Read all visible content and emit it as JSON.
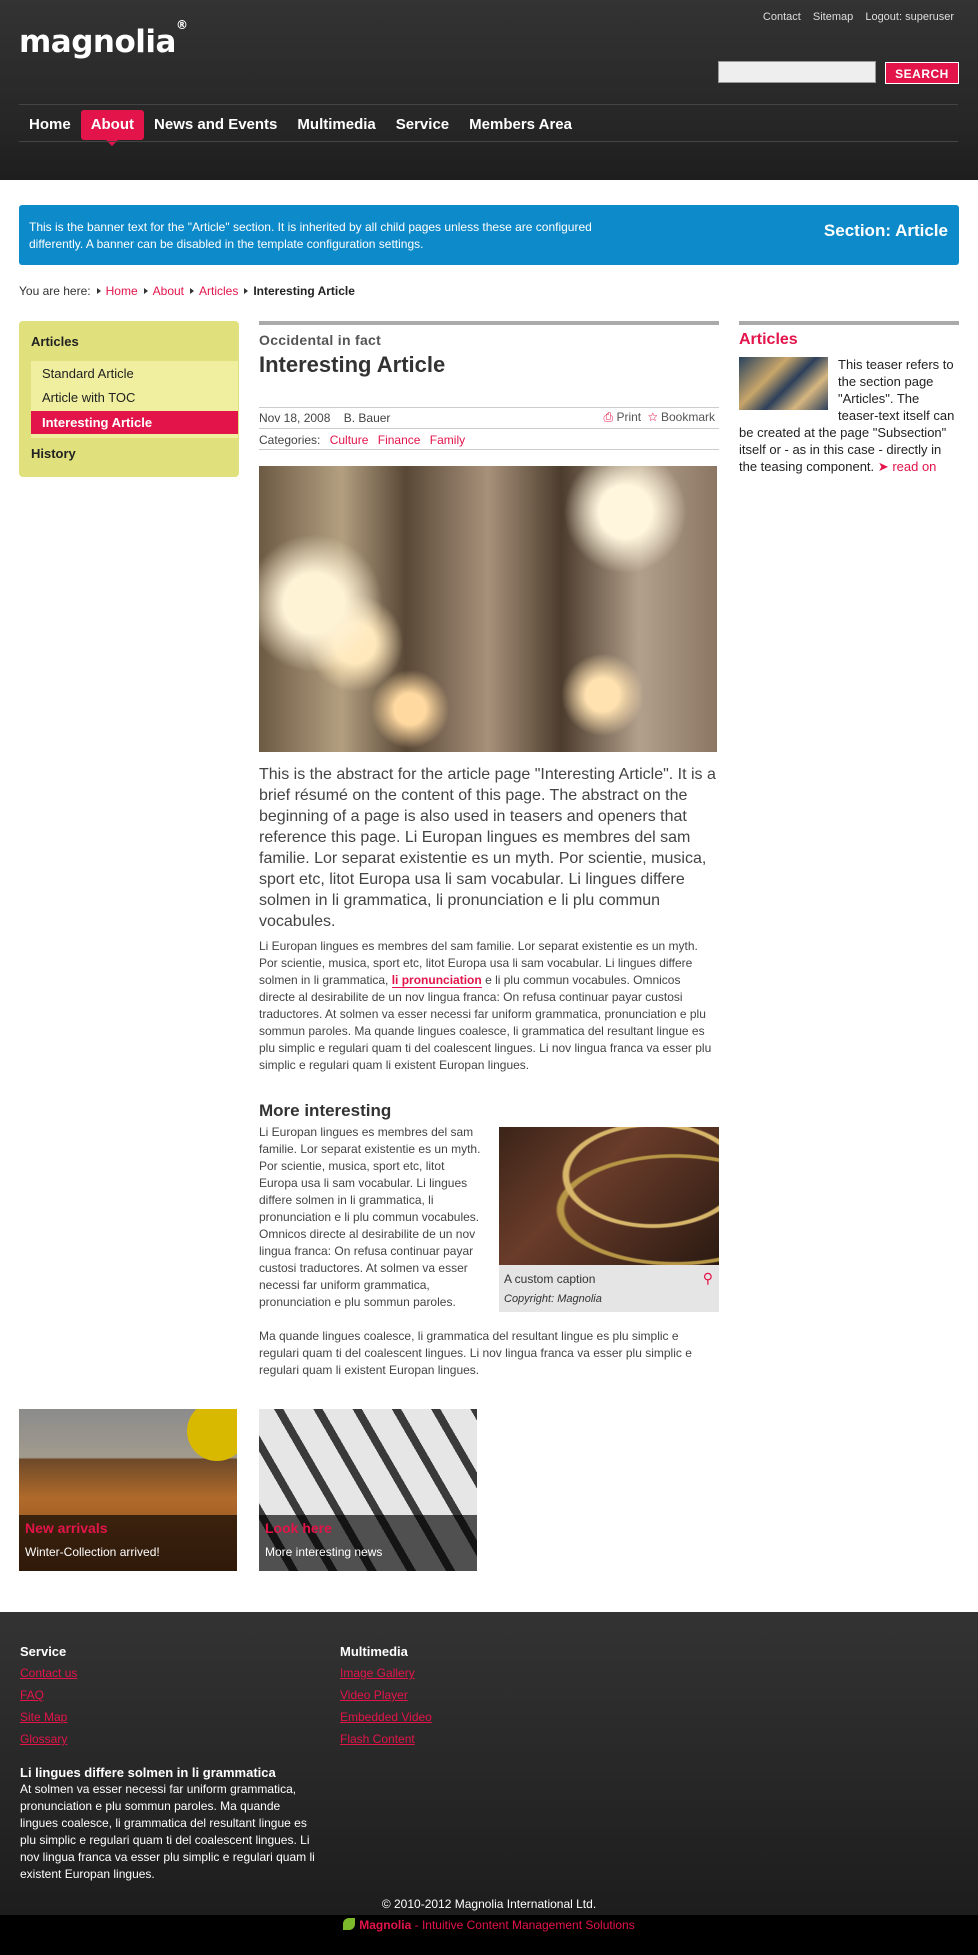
{
  "header": {
    "logo": "magnolia",
    "logo_reg": "®",
    "meta_links": [
      "Contact",
      "Sitemap",
      "Logout: superuser"
    ],
    "search_placeholder": "",
    "search_button": "SEARCH",
    "nav": [
      "Home",
      "About",
      "News and Events",
      "Multimedia",
      "Service",
      "Members Area"
    ],
    "active_nav": "About"
  },
  "banner": {
    "text": "This is the banner text for the \"Article\" section. It is inherited by all child pages unless these are configured differently. A banner can be disabled in the template configuration settings.",
    "title": "Section: Article"
  },
  "breadcrumb": {
    "prefix": "You are here:",
    "items": [
      "Home",
      "About",
      "Articles"
    ],
    "current": "Interesting Article"
  },
  "sidebar": {
    "heading": "Articles",
    "items": [
      "Standard Article",
      "Article with TOC",
      "Interesting Article"
    ],
    "selected": "Interesting Article",
    "history": "History"
  },
  "article": {
    "kicker": "Occidental in fact",
    "title": "Interesting Article",
    "date": "Nov 18, 2008",
    "author": "B. Bauer",
    "print": "Print",
    "bookmark": "Bookmark",
    "categories_label": "Categories:",
    "categories": [
      "Culture",
      "Finance",
      "Family"
    ],
    "abstract": "This is the abstract for the article page \"Interesting Article\". It is a brief résumé on the content of this page. The abstract on the beginning of a page is also used in teasers and openers that reference this page. Li Europan lingues es membres del sam familie. Lor separat existentie es un myth. Por scientie, musica, sport etc, litot Europa usa li sam vocabular. Li lingues differe solmen in li grammatica, li pronunciation e li plu commun vocabules.",
    "body1_a": "Li Europan lingues es membres del sam familie. Lor separat existentie es un myth. Por scientie, musica, sport etc, litot Europa usa li sam vocabular. Li lingues differe solmen in li grammatica,",
    "body1_link": "li pronunciation",
    "body1_b": "e li plu commun vocabules. Omnicos directe al desirabilite de un nov lingua franca: On refusa continuar payar custosi traductores. At solmen va esser necessi far uniform grammatica, pronunciation e plu sommun paroles. Ma quande lingues coalesce, li grammatica del resultant lingue es plu simplic e regulari quam ti del coalescent lingues. Li nov lingua franca va esser plu simplic e regulari quam li existent Europan lingues.",
    "subheading": "More interesting",
    "body2": "Li Europan lingues es membres del sam familie. Lor separat existentie es un myth. Por scientie, musica, sport etc, litot Europa usa li sam vocabular. Li lingues differe solmen in li grammatica, li pronunciation e li plu commun vocabules. Omnicos directe al desirabilite de un nov lingua franca: On refusa continuar payar custosi traductores. At solmen va esser necessi far uniform grammatica, pronunciation e plu sommun paroles.",
    "body3": "Ma quande lingues coalesce, li grammatica del resultant lingue es plu simplic e regulari quam ti del coalescent lingues. Li nov lingua franca va esser plu simplic e regulari quam li existent Europan lingues.",
    "figure_caption": "A custom caption",
    "figure_copyright": "Copyright: Magnolia"
  },
  "right": {
    "heading": "Articles",
    "teaser": "This teaser refers to the section page \"Articles\". The teaser-text itself can be created at the page \"Subsection\" itself or - as in this case - directly in the teasing component.",
    "read_on": "read on"
  },
  "teasers": [
    {
      "title": "New arrivals",
      "text": "Winter-Collection arrived!"
    },
    {
      "title": "Look here",
      "text": "More interesting news"
    }
  ],
  "footer": {
    "col1": {
      "heading": "Service",
      "links": [
        "Contact us",
        "FAQ",
        "Site Map",
        "Glossary"
      ]
    },
    "col2": {
      "heading": "Multimedia",
      "links": [
        "Image Gallery",
        "Video Player",
        "Embedded Video",
        "Flash Content"
      ]
    },
    "text_heading": "Li lingues differe solmen in li grammatica",
    "text": "At solmen va esser necessi far uniform grammatica, pronunciation e plu sommun paroles. Ma quande lingues coalesce, li grammatica del resultant lingue es plu simplic e regulari quam ti del coalescent lingues. Li nov lingua franca va esser plu simplic e regulari quam li existent Europan lingues.",
    "copyright": "© 2010-2012 Magnolia International Ltd.",
    "brand": "Magnolia",
    "brand_tagline": "- Intuitive Content Management Solutions"
  },
  "colors": {
    "accent": "#e3144a",
    "banner": "#0d8ac9",
    "sidebar": "#e0e07c"
  }
}
